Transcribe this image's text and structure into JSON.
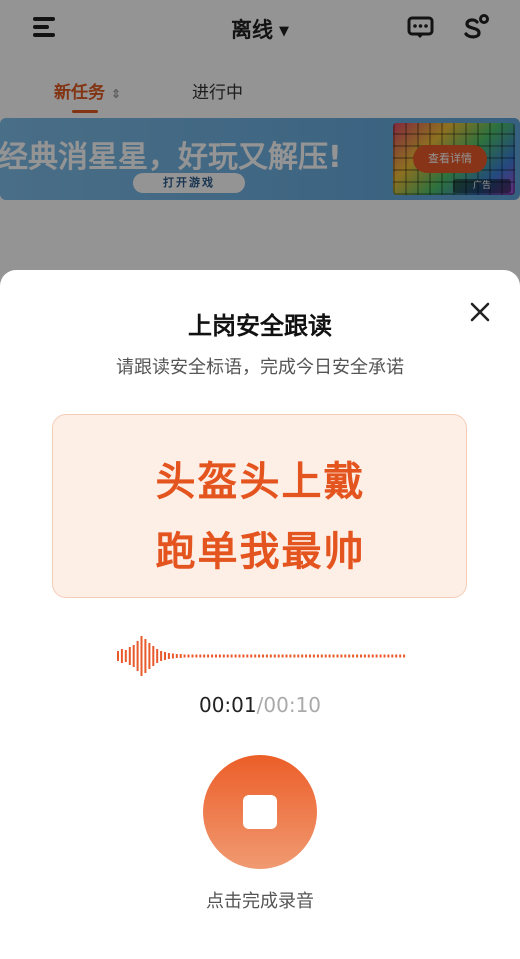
{
  "app": {
    "title": "离线",
    "tabs": [
      {
        "label": "新任务"
      },
      {
        "label": "进行中"
      }
    ],
    "banner": {
      "headline": "经典消星星，好玩又解压!",
      "button_label": "打开游戏",
      "thumb_button_label": "查看详情",
      "ad_label": "广告"
    }
  },
  "modal": {
    "title": "上岗安全跟读",
    "subtitle": "请跟读安全标语，完成今日安全承诺",
    "slogan": {
      "line1": "头盔头上戴",
      "line2": "跑单我最帅"
    },
    "timer": {
      "current": "00:01",
      "separator": "/",
      "total": "00:10"
    },
    "recording_progress": 0.1,
    "hint": "点击完成录音"
  },
  "colors": {
    "accent": "#e4541e",
    "card_bg": "#fdeee6",
    "waveform": "#e8592b"
  }
}
